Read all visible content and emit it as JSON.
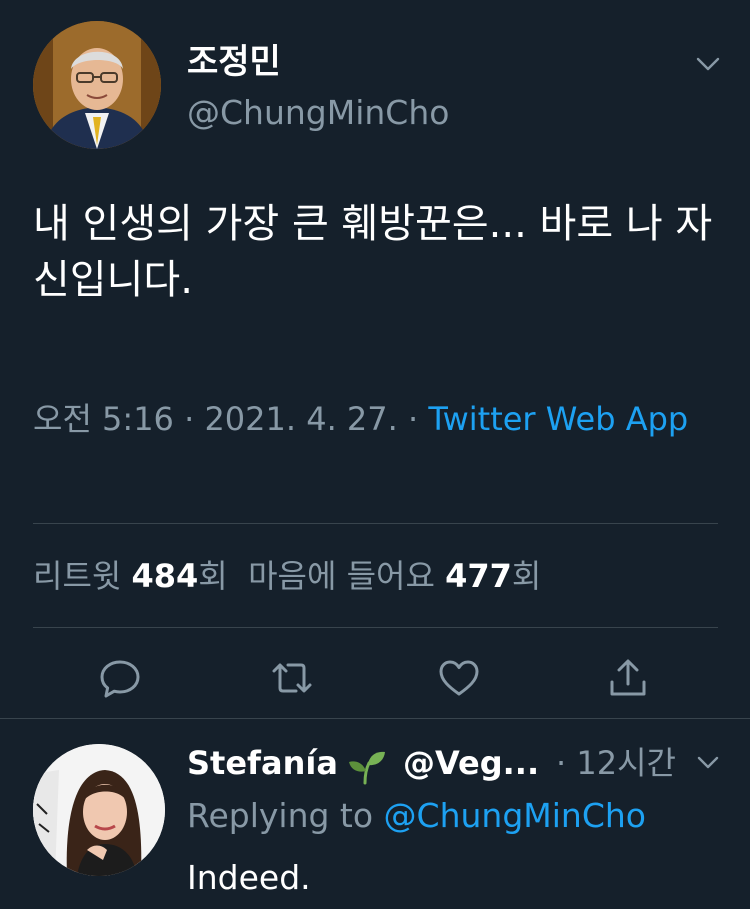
{
  "tweet": {
    "display_name": "조정민",
    "handle": "@ChungMinCho",
    "text": "내 인생의 가장 큰 훼방꾼은... 바로 나 자신입니다.",
    "time": "오전 5:16",
    "date": "2021. 4. 27.",
    "separator": "·",
    "source": "Twitter Web App",
    "stats": {
      "retweet_label": "리트윗",
      "retweet_count": "484",
      "count_suffix": "회",
      "like_label": "마음에 들어요",
      "like_count": "477"
    },
    "actions": [
      "reply-icon",
      "retweet-icon",
      "like-icon",
      "share-icon"
    ]
  },
  "reply": {
    "display_name": "Stefanía",
    "emoji": "seedling-icon",
    "handle": "@Veg...",
    "separator": "·",
    "time": "12시간",
    "replying_prefix": "Replying to",
    "replying_to": "@ChungMinCho",
    "text": "Indeed."
  },
  "colors": {
    "background": "#15202b",
    "text": "#ffffff",
    "secondary": "#8899a6",
    "accent": "#1da1f2",
    "divider": "#38444d"
  }
}
